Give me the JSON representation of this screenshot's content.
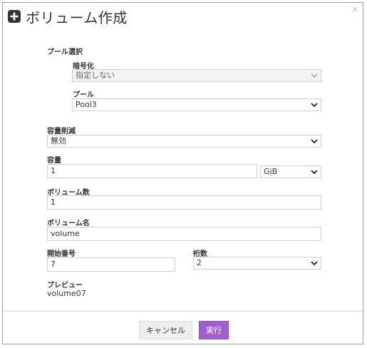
{
  "dialog": {
    "title": "ボリューム作成",
    "close_label": "×"
  },
  "pool_selection": {
    "section_label": "プール選択",
    "encryption_label": "暗号化",
    "encryption_value": "指定しない",
    "pool_label": "プール",
    "pool_value": "Pool3"
  },
  "capacity_reduction": {
    "label": "容量削減",
    "value": "無効"
  },
  "capacity": {
    "label": "容量",
    "value": "1",
    "unit": "GiB"
  },
  "volume_count": {
    "label": "ボリューム数",
    "value": "1"
  },
  "volume_name": {
    "label": "ボリューム名",
    "value": "volume"
  },
  "start_number": {
    "label": "開始番号",
    "value": "7"
  },
  "digits": {
    "label": "桁数",
    "value": "2"
  },
  "preview": {
    "label": "プレビュー",
    "value": "volume07"
  },
  "footer": {
    "cancel_label": "キャンセル",
    "run_label": "実行"
  },
  "colors": {
    "run_button": "#a25fd2",
    "border": "#cfcfcf"
  }
}
